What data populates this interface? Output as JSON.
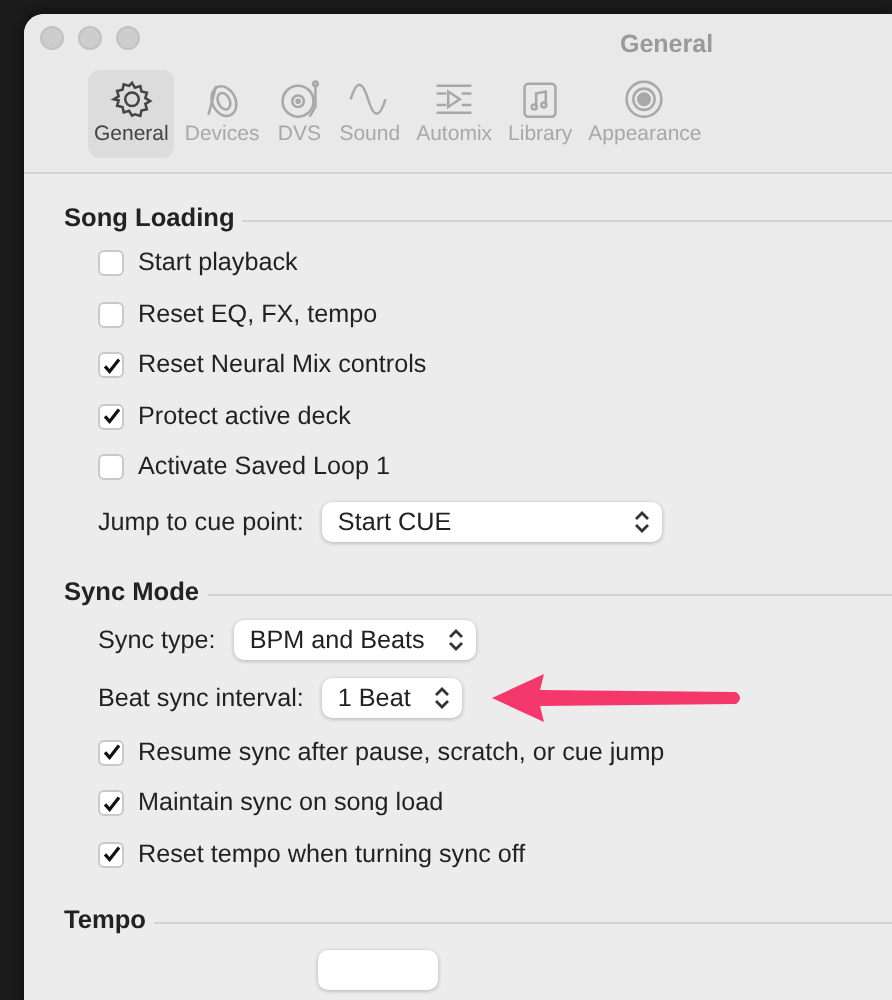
{
  "window": {
    "title": "General"
  },
  "toolbar": [
    {
      "label": "General",
      "selected": true
    },
    {
      "label": "Devices",
      "selected": false
    },
    {
      "label": "DVS",
      "selected": false
    },
    {
      "label": "Sound",
      "selected": false
    },
    {
      "label": "Automix",
      "selected": false
    },
    {
      "label": "Library",
      "selected": false
    },
    {
      "label": "Appearance",
      "selected": false
    }
  ],
  "sections": [
    {
      "title": "Song Loading",
      "rows": [
        {
          "kind": "checkbox",
          "label": "Start playback",
          "checked": false
        },
        {
          "kind": "checkbox",
          "label": "Reset EQ, FX, tempo",
          "checked": false
        },
        {
          "kind": "checkbox",
          "label": "Reset Neural Mix controls",
          "checked": true
        },
        {
          "kind": "checkbox",
          "label": "Protect active deck",
          "checked": true
        },
        {
          "kind": "checkbox",
          "label": "Activate Saved Loop 1",
          "checked": false
        },
        {
          "kind": "select",
          "label": "Jump to cue point:",
          "value": "Start CUE",
          "highlighted": false
        }
      ]
    },
    {
      "title": "Sync Mode",
      "rows": [
        {
          "kind": "select",
          "label": "Sync type:",
          "value": "BPM and Beats",
          "highlighted": false
        },
        {
          "kind": "select",
          "label": "Beat sync interval:",
          "value": "1 Beat",
          "highlighted": true
        },
        {
          "kind": "checkbox",
          "label": "Resume sync after pause, scratch, or cue jump",
          "checked": true
        },
        {
          "kind": "checkbox",
          "label": "Maintain sync on song load",
          "checked": true
        },
        {
          "kind": "checkbox",
          "label": "Reset tempo when turning sync off",
          "checked": true
        }
      ]
    },
    {
      "title": "Tempo",
      "rows": [
        {
          "kind": "select",
          "highlighted": false
        }
      ]
    }
  ]
}
